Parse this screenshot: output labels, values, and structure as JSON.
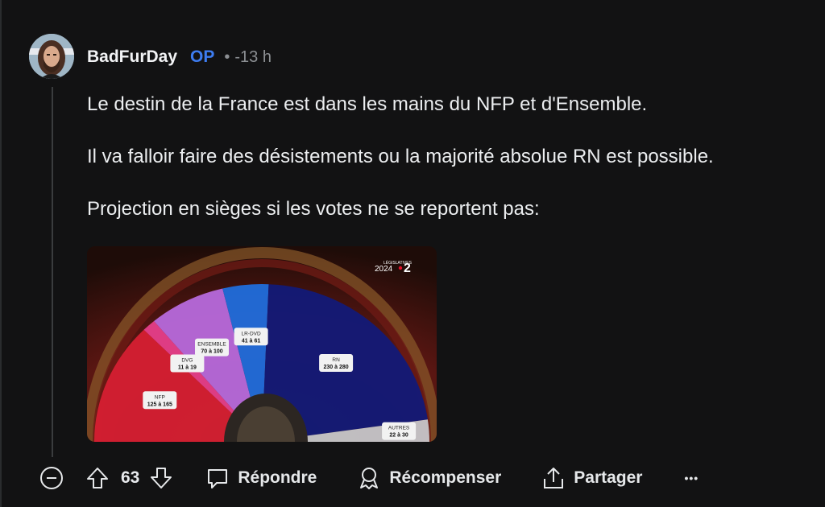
{
  "comment": {
    "username": "BadFurDay",
    "op_badge": "OP",
    "separator": "•",
    "time": "-13 h",
    "paragraphs": [
      "Le destin de la France est dans les mains du NFP et d'Ensemble.",
      "Il va falloir faire des désistements ou la majorité absolue RN est possible.",
      "Projection en sièges si les votes ne se reportent pas:"
    ]
  },
  "image": {
    "broadcaster_logo_small": "LÉGISLATIVES",
    "broadcaster_logo_year": "2024",
    "broadcaster_channel": "2"
  },
  "chart_data": {
    "type": "pie",
    "shape": "hemicycle",
    "slices": [
      {
        "name": "NFP",
        "label": "125 à 165",
        "min": 125,
        "max": 165,
        "color": "#d81f33"
      },
      {
        "name": "DVG",
        "label": "11 à 19",
        "min": 11,
        "max": 19,
        "color": "#e8408c"
      },
      {
        "name": "ENSEMBLE",
        "label": "70 à 100",
        "min": 70,
        "max": 100,
        "color": "#b96ce0"
      },
      {
        "name": "LR-DVD",
        "label": "41 à 61",
        "min": 41,
        "max": 61,
        "color": "#1f6fe0"
      },
      {
        "name": "RN",
        "label": "230 à 280",
        "min": 230,
        "max": 280,
        "color": "#111a7a"
      },
      {
        "name": "AUTRES",
        "label": "22 à 30",
        "min": 22,
        "max": 30,
        "color": "#c9cacd"
      }
    ]
  },
  "actions": {
    "upvote_count": "63",
    "reply_label": "Répondre",
    "award_label": "Récompenser",
    "share_label": "Partager",
    "more_label": "•••"
  },
  "icons": [
    "collapse-icon",
    "upvote-icon",
    "downvote-icon",
    "reply-icon",
    "award-icon",
    "share-icon"
  ],
  "colors": {
    "background": "#121213",
    "op_badge": "#3d7cf0",
    "meta_text": "#8c8f93"
  }
}
